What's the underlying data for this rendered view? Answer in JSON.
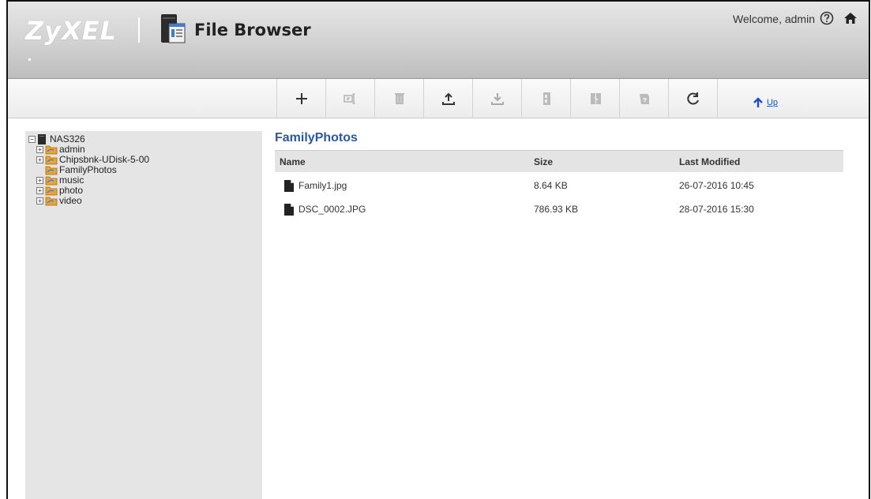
{
  "header": {
    "logo": "ZyXEL",
    "app_title": "File Browser",
    "welcome": "Welcome, admin"
  },
  "toolbar": {
    "buttons": [
      {
        "name": "add",
        "icon": "plus-icon",
        "enabled": true
      },
      {
        "name": "rename",
        "icon": "rename-icon",
        "enabled": false
      },
      {
        "name": "delete",
        "icon": "trash-icon",
        "enabled": false
      },
      {
        "name": "upload",
        "icon": "upload-icon",
        "enabled": true
      },
      {
        "name": "download",
        "icon": "download-icon",
        "enabled": false
      },
      {
        "name": "copy",
        "icon": "copy-icon",
        "enabled": false
      },
      {
        "name": "move",
        "icon": "move-icon",
        "enabled": false
      },
      {
        "name": "share",
        "icon": "share-icon",
        "enabled": false
      },
      {
        "name": "refresh",
        "icon": "refresh-icon",
        "enabled": true
      }
    ],
    "up_label": "Up"
  },
  "tree": {
    "root": "NAS326",
    "items": [
      {
        "label": "admin",
        "expandable": true
      },
      {
        "label": "Chipsbnk-UDisk-5-00",
        "expandable": true
      },
      {
        "label": "FamilyPhotos",
        "expandable": false
      },
      {
        "label": "music",
        "expandable": true
      },
      {
        "label": "photo",
        "expandable": true
      },
      {
        "label": "video",
        "expandable": true
      }
    ]
  },
  "main": {
    "folder_title": "FamilyPhotos",
    "columns": {
      "name": "Name",
      "size": "Size",
      "modified": "Last Modified"
    },
    "files": [
      {
        "name": "Family1.jpg",
        "size": "8.64 KB",
        "modified": "26-07-2016 10:45"
      },
      {
        "name": "DSC_0002.JPG",
        "size": "786.93 KB",
        "modified": "28-07-2016 15:30"
      }
    ]
  },
  "colors": {
    "accent": "#2a5a9e",
    "link": "#1a4fd0",
    "folder": "#e8a33a"
  }
}
